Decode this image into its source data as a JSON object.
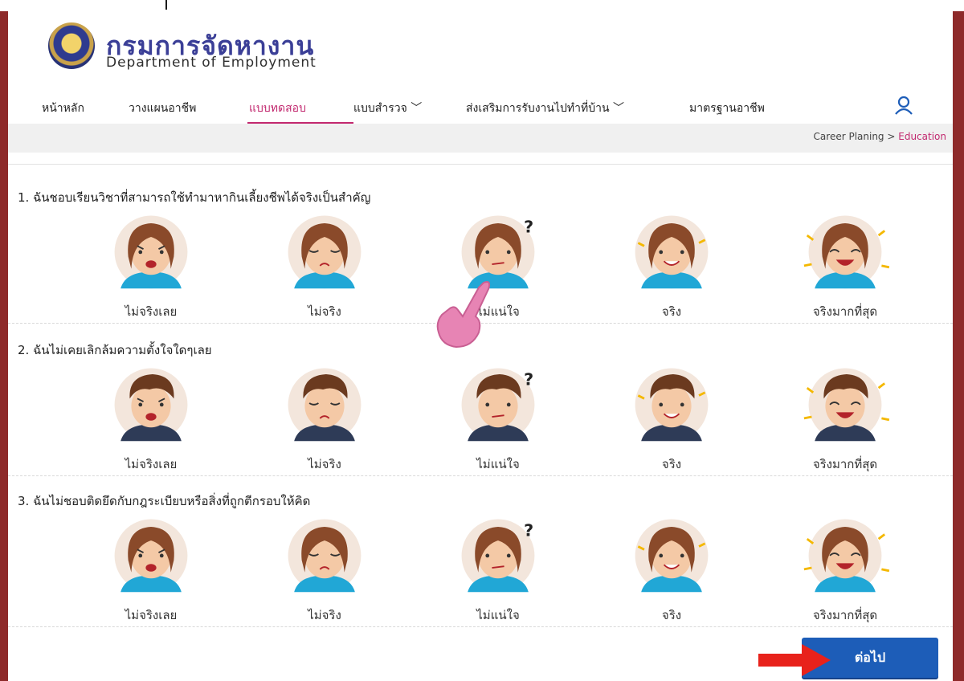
{
  "site": {
    "name_th": "กรมการจัดหางาน",
    "name_en": "Department of Employment"
  },
  "nav": {
    "items": [
      {
        "label": "หน้าหลัก"
      },
      {
        "label": "วางแผนอาชีพ"
      },
      {
        "label": "แบบทดสอบ"
      },
      {
        "label": "แบบสำรวจ ﹀"
      },
      {
        "label": "ส่งเสริมการรับงานไปทำที่บ้าน ﹀"
      },
      {
        "label": "มาตรฐานอาชีพ"
      }
    ],
    "active_index": 2,
    "accent_color": "#c2296f"
  },
  "breadcrumb": {
    "root": "Career Planing",
    "separator": " > ",
    "current": "Education"
  },
  "questions": [
    {
      "title": "1. ฉันชอบเรียนวิชาที่สามารถใช้ทำมาหากินเลี้ยงชีพได้จริงเป็นสำคัญ",
      "avatar": "woman",
      "options": [
        "ไม่จริงเลย",
        "ไม่จริง",
        "ไม่แน่ใจ",
        "จริง",
        "จริงมากที่สุด"
      ]
    },
    {
      "title": "2. ฉันไม่เคยเลิกล้มความตั้งใจใดๆเลย",
      "avatar": "man",
      "options": [
        "ไม่จริงเลย",
        "ไม่จริง",
        "ไม่แน่ใจ",
        "จริง",
        "จริงมากที่สุด"
      ]
    },
    {
      "title": "3. ฉันไม่ชอบติดยึดกับกฎระเบียบหรือสิ่งที่ถูกตีกรอบให้คิด",
      "avatar": "woman",
      "options": [
        "ไม่จริงเลย",
        "ไม่จริง",
        "ไม่แน่ใจ",
        "จริง",
        "จริงมากที่สุด"
      ]
    }
  ],
  "expressions": [
    "angry",
    "sad",
    "confused",
    "happy",
    "very-happy"
  ],
  "next_button": {
    "label": "ต่อไป",
    "color": "#1d5db8"
  },
  "annotations": {
    "arrow_color": "#e8221b",
    "hand_color": "#e784b4"
  }
}
